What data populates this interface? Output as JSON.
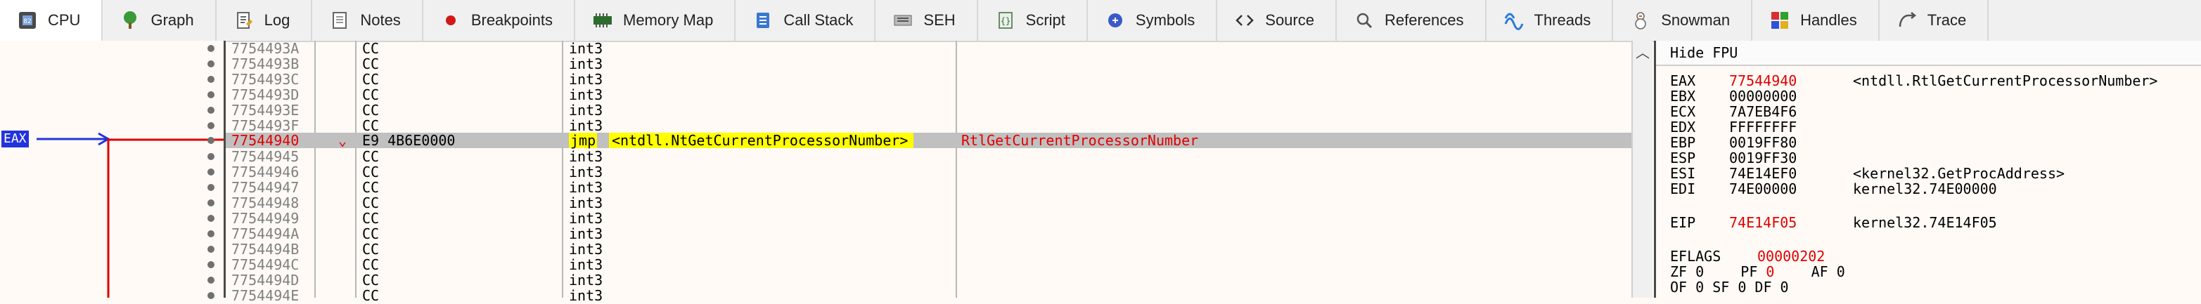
{
  "tabs": [
    {
      "label": "CPU",
      "icon": "cpu-icon",
      "active": true
    },
    {
      "label": "Graph",
      "icon": "graph-icon"
    },
    {
      "label": "Log",
      "icon": "log-icon"
    },
    {
      "label": "Notes",
      "icon": "notes-icon"
    },
    {
      "label": "Breakpoints",
      "icon": "breakpoint-icon"
    },
    {
      "label": "Memory Map",
      "icon": "memory-map-icon"
    },
    {
      "label": "Call Stack",
      "icon": "call-stack-icon"
    },
    {
      "label": "SEH",
      "icon": "seh-icon"
    },
    {
      "label": "Script",
      "icon": "script-icon"
    },
    {
      "label": "Symbols",
      "icon": "symbols-icon"
    },
    {
      "label": "Source",
      "icon": "source-icon"
    },
    {
      "label": "References",
      "icon": "references-icon"
    },
    {
      "label": "Threads",
      "icon": "threads-icon"
    },
    {
      "label": "Snowman",
      "icon": "snowman-icon"
    },
    {
      "label": "Handles",
      "icon": "handles-icon"
    },
    {
      "label": "Trace",
      "icon": "trace-icon"
    }
  ],
  "gutter": {
    "eip_label": "EAX"
  },
  "disasm": {
    "rows": [
      {
        "addr": "7754493A",
        "bytes": "CC",
        "instr": "int3"
      },
      {
        "addr": "7754493B",
        "bytes": "CC",
        "instr": "int3"
      },
      {
        "addr": "7754493C",
        "bytes": "CC",
        "instr": "int3"
      },
      {
        "addr": "7754493D",
        "bytes": "CC",
        "instr": "int3"
      },
      {
        "addr": "7754493E",
        "bytes": "CC",
        "instr": "int3"
      },
      {
        "addr": "7754493F",
        "bytes": "CC",
        "instr": "int3"
      },
      {
        "addr": "77544940",
        "bytes": "E9 4B6E0000",
        "instr": "jmp",
        "target": "<ntdll.NtGetCurrentProcessorNumber>",
        "comment": "RtlGetCurrentProcessorNumber",
        "selected": true
      },
      {
        "addr": "77544945",
        "bytes": "CC",
        "instr": "int3"
      },
      {
        "addr": "77544946",
        "bytes": "CC",
        "instr": "int3"
      },
      {
        "addr": "77544947",
        "bytes": "CC",
        "instr": "int3"
      },
      {
        "addr": "77544948",
        "bytes": "CC",
        "instr": "int3"
      },
      {
        "addr": "77544949",
        "bytes": "CC",
        "instr": "int3"
      },
      {
        "addr": "7754494A",
        "bytes": "CC",
        "instr": "int3"
      },
      {
        "addr": "7754494B",
        "bytes": "CC",
        "instr": "int3"
      },
      {
        "addr": "7754494C",
        "bytes": "CC",
        "instr": "int3"
      },
      {
        "addr": "7754494D",
        "bytes": "CC",
        "instr": "int3"
      },
      {
        "addr": "7754494E",
        "bytes": "CC",
        "instr": "int3"
      }
    ]
  },
  "registers": {
    "hide_fpu_label": "Hide FPU",
    "items": [
      {
        "name": "EAX",
        "value": "77544940",
        "comment": "<ntdll.RtlGetCurrentProcessorNumber>",
        "changed": true
      },
      {
        "name": "EBX",
        "value": "00000000",
        "comment": ""
      },
      {
        "name": "ECX",
        "value": "7A7EB4F6",
        "comment": ""
      },
      {
        "name": "EDX",
        "value": "FFFFFFFF",
        "comment": ""
      },
      {
        "name": "EBP",
        "value": "0019FF80",
        "comment": ""
      },
      {
        "name": "ESP",
        "value": "0019FF30",
        "comment": ""
      },
      {
        "name": "ESI",
        "value": "74E14EF0",
        "comment": "<kernel32.GetProcAddress>"
      },
      {
        "name": "EDI",
        "value": "74E00000",
        "comment": "kernel32.74E00000"
      }
    ],
    "eip": {
      "name": "EIP",
      "value": "74E14F05",
      "comment": "kernel32.74E14F05"
    },
    "eflags": {
      "name": "EFLAGS",
      "value": "00000202"
    },
    "flags_line": {
      "zf_label": "ZF",
      "zf": "0",
      "pf_label": "PF",
      "pf": "0",
      "af_label": "AF",
      "af": "0"
    },
    "flags_line2_partial": "OF 0  SF 0  DF 0"
  },
  "colors": {
    "accent_red": "#e00000",
    "eip_blue": "#2233dd",
    "jump_yellow": "#ffff00",
    "selection_grey": "#c0c0c0"
  }
}
